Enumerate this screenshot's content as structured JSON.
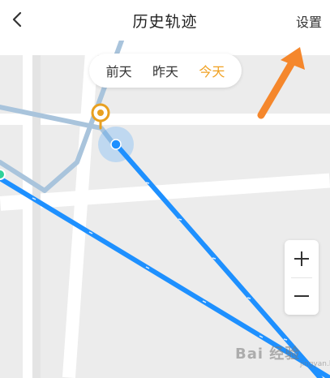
{
  "header": {
    "title": "历史轨迹",
    "settings_label": "设置"
  },
  "day_selector": {
    "tabs": [
      {
        "label": "前天",
        "active": false
      },
      {
        "label": "昨天",
        "active": false
      },
      {
        "label": "今天",
        "active": true
      }
    ]
  },
  "zoom": {
    "in_label": "+",
    "out_label": "−"
  },
  "icons": {
    "back": "chevron-left-icon",
    "marker": "location-pin-icon",
    "current_position": "current-location-dot-icon",
    "annotation": "orange-arrow-icon"
  },
  "watermark": {
    "text": "Bai 经验",
    "sub": "jingyan.baidu.com"
  },
  "colors": {
    "track": "#1e90ff",
    "track_faded": "#a9c4dc",
    "active_tab": "#f0a020",
    "annotation_arrow": "#f5872c",
    "pin": "#e8a020"
  }
}
